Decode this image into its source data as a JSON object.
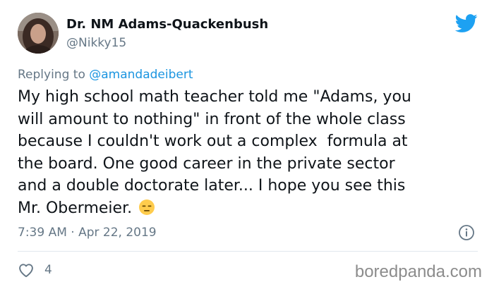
{
  "tweet": {
    "author": {
      "display_name": "Dr. NM Adams-Quackenbush",
      "handle": "@Nikky15"
    },
    "reply": {
      "prefix": "Replying to ",
      "mention": "@amandadeibert"
    },
    "text_lines": [
      "My high school math teacher told me \"Adams, you",
      "will amount to nothing\" in front of the whole class",
      "because I couldn't work out a complex  formula at",
      "the board. One good career in the private sector",
      "and a double doctorate later... I hope you see this",
      "Mr. Obermeier."
    ],
    "emoji": "expressionless-face-emoji",
    "timestamp": "7:39 AM · Apr 22, 2019",
    "like_count": "4"
  },
  "watermark": "boredpanda.com",
  "icons": {
    "brand": "twitter-bird-icon",
    "info": "info-icon",
    "like": "heart-icon"
  },
  "colors": {
    "twitter_blue": "#1da1f2",
    "mention": "#1b95e0",
    "secondary_text": "#657786"
  }
}
